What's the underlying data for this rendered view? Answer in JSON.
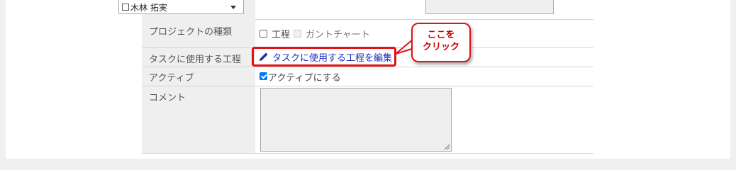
{
  "form": {
    "assignee": {
      "selected": "木林 拓実"
    },
    "project_type": {
      "label": "プロジェクトの種類",
      "options": [
        {
          "label": "工程",
          "checked": false,
          "disabled": false
        },
        {
          "label": "ガントチャート",
          "checked": false,
          "disabled": true
        }
      ]
    },
    "task_process": {
      "label": "タスクに使用する工程",
      "edit_link": "タスクに使用する工程を編集"
    },
    "active": {
      "label": "アクティブ",
      "checkbox_label": "アクティブにする",
      "checked": true
    },
    "comment": {
      "label": "コメント",
      "value": ""
    }
  },
  "callout": {
    "line1": "ここを",
    "line2": "クリック",
    "color": "#e01212"
  },
  "icons": {
    "edit": "pencil-icon"
  }
}
